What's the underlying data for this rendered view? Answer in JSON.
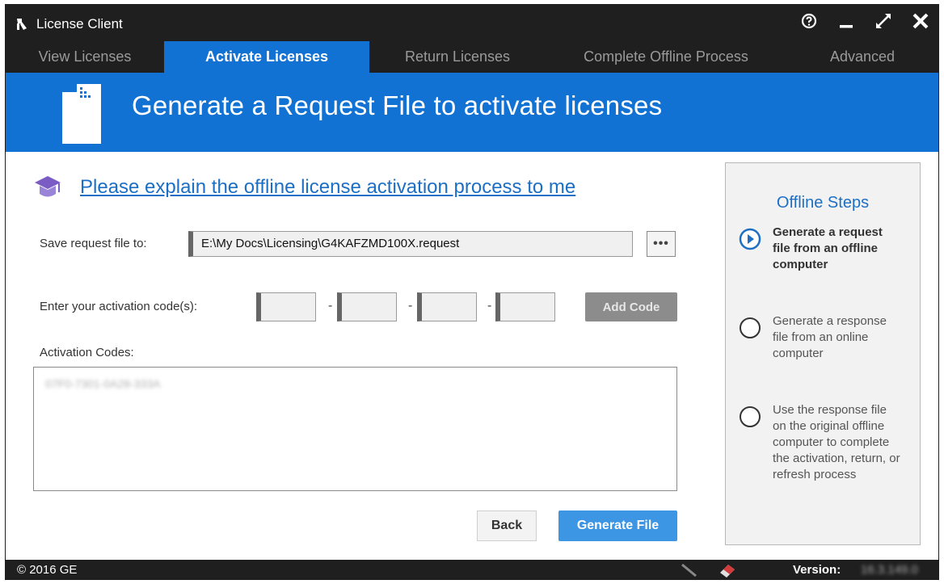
{
  "window": {
    "title": "License Client",
    "controls": [
      "help-icon",
      "minimize-icon",
      "maximize-icon",
      "close-icon"
    ]
  },
  "tabs": [
    {
      "label": "View Licenses",
      "active": false
    },
    {
      "label": "Activate Licenses",
      "active": true
    },
    {
      "label": "Return Licenses",
      "active": false
    },
    {
      "label": "Complete Offline Process",
      "active": false
    },
    {
      "label": "Advanced",
      "active": false
    }
  ],
  "header": {
    "icon": "document-icon",
    "title": "Generate a Request File to activate licenses"
  },
  "content": {
    "explain_link": "Please explain the offline license activation process to me",
    "save_label": "Save request file to:",
    "save_path": "E:\\My Docs\\Licensing\\G4KAFZMD100X.request",
    "browse_label": "•••",
    "activation_label": "Enter your activation code(s):",
    "code_separator": "-",
    "add_code_label": "Add Code",
    "codes_label": "Activation Codes:",
    "codes_list": [
      "07F0-7301-0A28-333A"
    ],
    "back_label": "Back",
    "generate_label": "Generate File"
  },
  "steps": {
    "title": "Offline Steps",
    "items": [
      {
        "label": "Generate a request file from an offline computer",
        "current": true
      },
      {
        "label": "Generate a response file from an online computer",
        "current": false
      },
      {
        "label": "Use the response file on the original offline computer to complete the activation, return, or refresh process",
        "current": false
      }
    ]
  },
  "status": {
    "copyright": "© 2016 GE",
    "version_label": "Version:",
    "version_value": "16.3.149.0"
  },
  "colors": {
    "accent": "#1272d3",
    "link": "#1c6fc5",
    "dark": "#1f1f1f",
    "generate_button": "#3d96e4"
  }
}
